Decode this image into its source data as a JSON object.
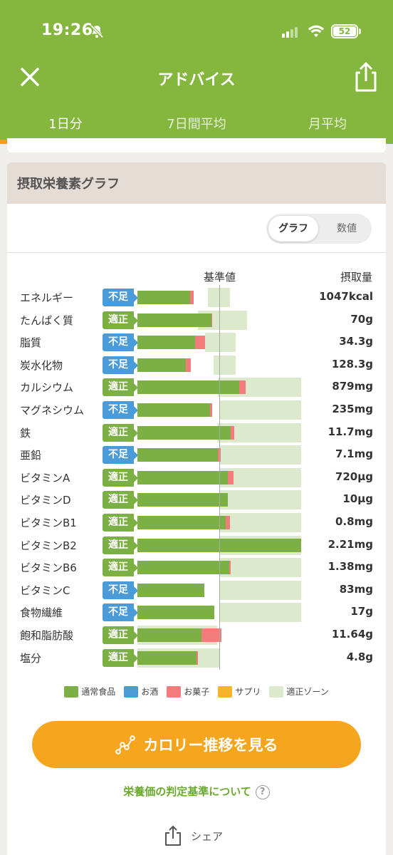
{
  "status_bar": {
    "time": "19:26",
    "battery": "52"
  },
  "nav": {
    "title": "アドバイス"
  },
  "tabs": [
    {
      "label": "1日分",
      "active": true
    },
    {
      "label": "7日間平均",
      "active": false
    },
    {
      "label": "月平均",
      "active": false
    }
  ],
  "section": {
    "title": "摂取栄養素グラフ",
    "toggle": {
      "graph": "グラフ",
      "numeric": "数値",
      "selected": "グラフ"
    },
    "header_reference": "基準値",
    "header_amount": "摂取量"
  },
  "nutrients": [
    {
      "name": "エネルギー",
      "status": "不足",
      "value": "1047kcal"
    },
    {
      "name": "たんぱく質",
      "status": "適正",
      "value": "70g"
    },
    {
      "name": "脂質",
      "status": "不足",
      "value": "34.3g"
    },
    {
      "name": "炭水化物",
      "status": "不足",
      "value": "128.3g"
    },
    {
      "name": "カルシウム",
      "status": "適正",
      "value": "879mg"
    },
    {
      "name": "マグネシウム",
      "status": "不足",
      "value": "235mg"
    },
    {
      "name": "鉄",
      "status": "適正",
      "value": "11.7mg"
    },
    {
      "name": "亜鉛",
      "status": "不足",
      "value": "7.1mg"
    },
    {
      "name": "ビタミンA",
      "status": "適正",
      "value": "720µg"
    },
    {
      "name": "ビタミンD",
      "status": "適正",
      "value": "10µg"
    },
    {
      "name": "ビタミンB1",
      "status": "適正",
      "value": "0.8mg"
    },
    {
      "name": "ビタミンB2",
      "status": "適正",
      "value": "2.21mg"
    },
    {
      "name": "ビタミンB6",
      "status": "適正",
      "value": "1.38mg"
    },
    {
      "name": "ビタミンC",
      "status": "不足",
      "value": "83mg"
    },
    {
      "name": "食物繊維",
      "status": "不足",
      "value": "17g"
    },
    {
      "name": "飽和脂肪酸",
      "status": "適正",
      "value": "11.64g"
    },
    {
      "name": "塩分",
      "status": "適正",
      "value": "4.8g"
    }
  ],
  "chart_data": {
    "type": "bar",
    "categories": [
      "エネルギー",
      "たんぱく質",
      "脂質",
      "炭水化物",
      "カルシウム",
      "マグネシウム",
      "鉄",
      "亜鉛",
      "ビタミンA",
      "ビタミンD",
      "ビタミンB1",
      "ビタミンB2",
      "ビタミンB6",
      "ビタミンC",
      "食物繊維",
      "飽和脂肪酸",
      "塩分"
    ],
    "unit": "ratio to reference value (1.0 = 基準値)",
    "series": [
      {
        "name": "通常食品",
        "values": [
          0.64,
          0.9,
          0.7,
          0.59,
          1.24,
          0.89,
          1.14,
          0.98,
          1.1,
          1.1,
          1.08,
          2.0,
          1.12,
          0.82,
          0.94,
          0.78,
          0.72
        ]
      },
      {
        "name": "お菓子",
        "values": [
          0.05,
          0.01,
          0.13,
          0.06,
          0.08,
          0.02,
          0.04,
          0.04,
          0.07,
          0.0,
          0.05,
          0.0,
          0.02,
          0.0,
          0.0,
          0.25,
          0.02
        ]
      }
    ],
    "zone_start": [
      0.86,
      0.74,
      0.83,
      0.93,
      0.98,
      1.0,
      0.97,
      1.0,
      1.0,
      1.0,
      1.0,
      1.0,
      1.0,
      1.0,
      1.0,
      0.0,
      0.0
    ],
    "zone_end": [
      1.13,
      1.34,
      1.2,
      1.2,
      2.0,
      2.0,
      2.0,
      2.0,
      2.0,
      2.0,
      2.0,
      2.0,
      2.0,
      2.0,
      2.0,
      0.97,
      1.0
    ],
    "reference": 1.0,
    "xlim": [
      0,
      2.0
    ]
  },
  "legend": [
    {
      "label": "通常食品",
      "color": "#7db044"
    },
    {
      "label": "お酒",
      "color": "#4a9bd8"
    },
    {
      "label": "お菓子",
      "color": "#f27b7b"
    },
    {
      "label": "サプリ",
      "color": "#f6b42b"
    },
    {
      "label": "適正ゾーン",
      "color": "#dde9cd"
    }
  ],
  "cta": {
    "label": "カロリー推移を見る"
  },
  "criteria_link": "栄養価の判定基準について",
  "share": "シェア"
}
